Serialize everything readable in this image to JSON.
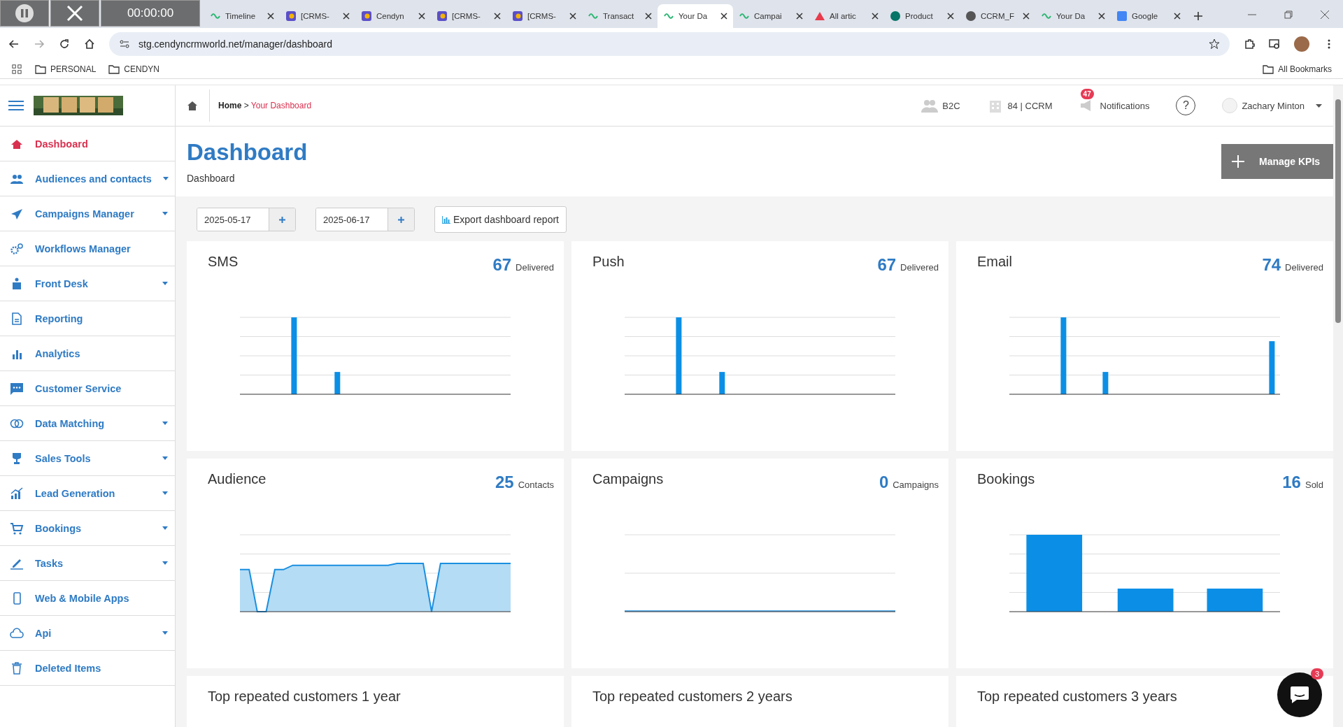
{
  "browser": {
    "tabs": [
      {
        "title": "Timeline",
        "selected": false
      },
      {
        "title": "[CRMS-",
        "selected": false
      },
      {
        "title": "Cendyn",
        "selected": false
      },
      {
        "title": "[CRMS-",
        "selected": false
      },
      {
        "title": "[CRMS-",
        "selected": false
      },
      {
        "title": "Transact",
        "selected": false
      },
      {
        "title": "Your Da",
        "selected": true
      },
      {
        "title": "Campai",
        "selected": false
      },
      {
        "title": "All artic",
        "selected": false
      },
      {
        "title": "Product",
        "selected": false
      },
      {
        "title": "CCRM_F",
        "selected": false
      },
      {
        "title": "Your Da",
        "selected": false
      },
      {
        "title": "Google",
        "selected": false
      }
    ],
    "url": "stg.cendyncrmworld.net/manager/dashboard",
    "bookmarks": [
      "PERSONAL",
      "CENDYN"
    ],
    "all_bookmarks": "All Bookmarks"
  },
  "recorder": {
    "timer": "00:00:00"
  },
  "sidebar": {
    "items": [
      {
        "label": "Dashboard",
        "selected": true,
        "submenu": false
      },
      {
        "label": "Audiences and contacts",
        "selected": false,
        "submenu": true
      },
      {
        "label": "Campaigns Manager",
        "selected": false,
        "submenu": true
      },
      {
        "label": "Workflows Manager",
        "selected": false,
        "submenu": false
      },
      {
        "label": "Front Desk",
        "selected": false,
        "submenu": true
      },
      {
        "label": "Reporting",
        "selected": false,
        "submenu": false
      },
      {
        "label": "Analytics",
        "selected": false,
        "submenu": false
      },
      {
        "label": "Customer Service",
        "selected": false,
        "submenu": false
      },
      {
        "label": "Data Matching",
        "selected": false,
        "submenu": true
      },
      {
        "label": "Sales Tools",
        "selected": false,
        "submenu": true
      },
      {
        "label": "Lead Generation",
        "selected": false,
        "submenu": true
      },
      {
        "label": "Bookings",
        "selected": false,
        "submenu": true
      },
      {
        "label": "Tasks",
        "selected": false,
        "submenu": true
      },
      {
        "label": "Web & Mobile Apps",
        "selected": false,
        "submenu": false
      },
      {
        "label": "Api",
        "selected": false,
        "submenu": true
      },
      {
        "label": "Deleted Items",
        "selected": false,
        "submenu": false
      }
    ]
  },
  "header": {
    "breadcrumb": {
      "home": "Home",
      "separator": ">",
      "current": "Your Dashboard"
    },
    "b2c": "B2C",
    "property": "84 | CCRM",
    "notifications": {
      "label": "Notifications",
      "badge": "47"
    },
    "help": "?",
    "user": "Zachary Minton"
  },
  "page": {
    "title": "Dashboard",
    "subtitle": "Dashboard",
    "manage_button": "Manage KPIs"
  },
  "filters": {
    "start_date": "2025-05-17",
    "end_date": "2025-06-17",
    "export_button": "Export dashboard report"
  },
  "cards": [
    {
      "title": "SMS",
      "value": "67",
      "unit": "Delivered"
    },
    {
      "title": "Push",
      "value": "67",
      "unit": "Delivered"
    },
    {
      "title": "Email",
      "value": "74",
      "unit": "Delivered"
    },
    {
      "title": "Audience",
      "value": "25",
      "unit": "Contacts"
    },
    {
      "title": "Campaigns",
      "value": "0",
      "unit": "Campaigns"
    },
    {
      "title": "Bookings",
      "value": "16",
      "unit": "Sold"
    },
    {
      "title": "Top repeated customers 1 year"
    },
    {
      "title": "Top repeated customers 2 years"
    },
    {
      "title": "Top repeated customers 3 years"
    }
  ],
  "chat": {
    "badge": "3"
  }
}
